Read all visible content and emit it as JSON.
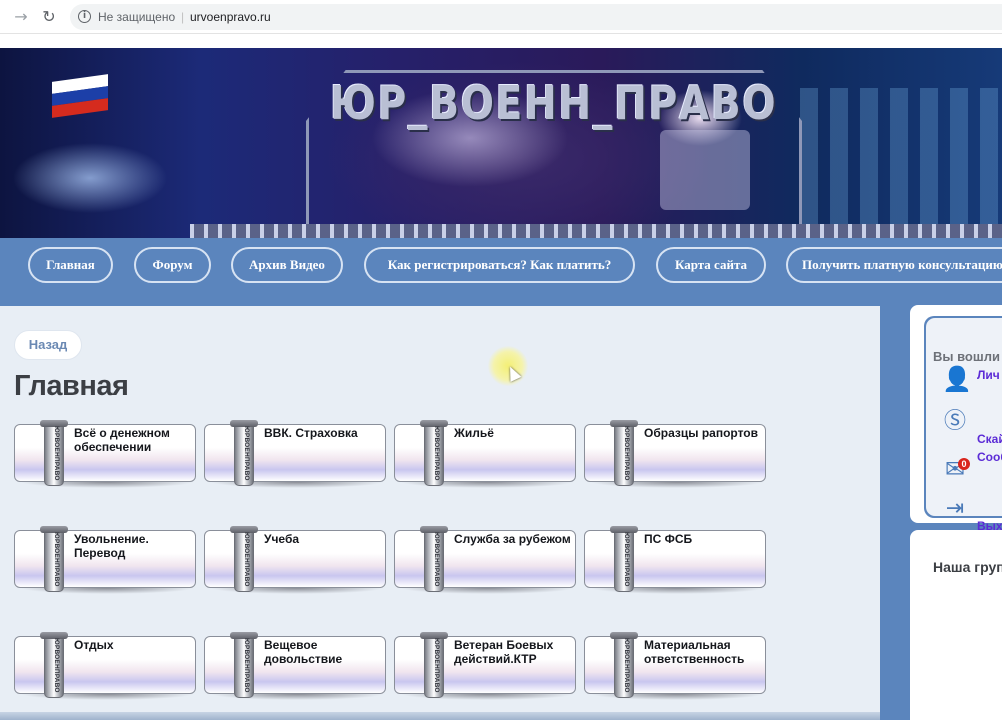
{
  "browser": {
    "security_text": "Не защищено",
    "url": "urvoenpravo.ru",
    "forward_icon": "arrow-right-icon",
    "reload_icon": "reload-icon",
    "info_icon": "info-icon"
  },
  "banner": {
    "logo_text": "ЮР_ВОЕНН_ПРАВО",
    "flag_colors": [
      "#ffffff",
      "#1c3fa8",
      "#d52b1e"
    ]
  },
  "nav": {
    "items": [
      {
        "label": "Главная"
      },
      {
        "label": "Форум"
      },
      {
        "label": "Архив Видео"
      },
      {
        "label": "Как регистрироваться? Как платить?"
      },
      {
        "label": "Карта сайта"
      },
      {
        "label": "Получить платную консультацию"
      }
    ]
  },
  "main": {
    "back_label": "Назад",
    "title": "Главная",
    "tile_brand": "ЮРВОЕНПРАВО",
    "tiles": [
      {
        "label": "Всё о денежном обеспечении"
      },
      {
        "label": "ВВК. Страховка"
      },
      {
        "label": "Жильё"
      },
      {
        "label": "Образцы рапортов"
      },
      {
        "label": "Увольнение. Перевод"
      },
      {
        "label": "Учеба"
      },
      {
        "label": "Служба за рубежом"
      },
      {
        "label": "ПС ФСБ"
      },
      {
        "label": "Отдых"
      },
      {
        "label": "Вещевое довольствие"
      },
      {
        "label": "Ветеран Боевых действий.КТР"
      },
      {
        "label": "Материальная ответственность"
      }
    ]
  },
  "sidebar": {
    "logged_in_text": "Вы вошли",
    "links": [
      {
        "label": "Лич",
        "icon": "user-icon"
      },
      {
        "label": "Скай",
        "icon": "skype-icon"
      },
      {
        "label": "Сооб",
        "icon": "mail-icon",
        "badge": "0"
      },
      {
        "label": "Вых",
        "icon": "logout-icon"
      }
    ],
    "group_title": "Наша груп"
  },
  "colors": {
    "nav_bg": "#5b85bd",
    "content_bg": "#e8eef5",
    "sidebar_link": "#5b2bd6"
  }
}
